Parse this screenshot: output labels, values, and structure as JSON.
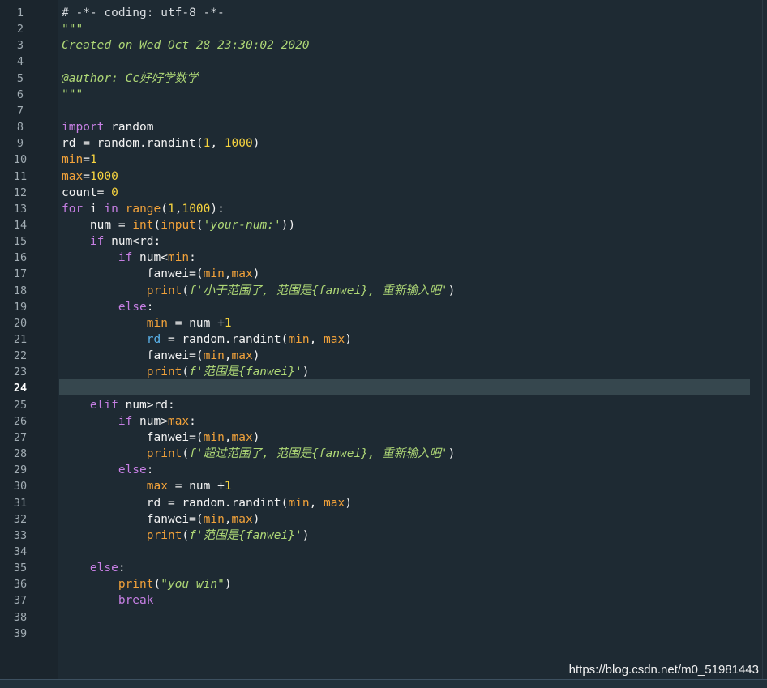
{
  "editor": {
    "current_line": 24,
    "lines": [
      [
        [
          "c",
          "# -*- coding: utf-8 -*-"
        ]
      ],
      [
        [
          "s",
          "\"\"\""
        ]
      ],
      [
        [
          "s",
          "Created on Wed Oct 28 23:30:02 2020"
        ]
      ],
      [],
      [
        [
          "s",
          "@author: Cc好好学数学"
        ]
      ],
      [
        [
          "s",
          "\"\"\""
        ]
      ],
      [],
      [
        [
          "k",
          "import"
        ],
        [
          "p",
          " random"
        ]
      ],
      [
        [
          "p",
          "rd = random.randint("
        ],
        [
          "n",
          "1"
        ],
        [
          "p",
          ", "
        ],
        [
          "n",
          "1000"
        ],
        [
          "p",
          ")"
        ]
      ],
      [
        [
          "v",
          "min"
        ],
        [
          "p",
          "="
        ],
        [
          "n",
          "1"
        ]
      ],
      [
        [
          "v",
          "max"
        ],
        [
          "p",
          "="
        ],
        [
          "n",
          "1000"
        ]
      ],
      [
        [
          "p",
          "count= "
        ],
        [
          "n",
          "0"
        ]
      ],
      [
        [
          "k",
          "for"
        ],
        [
          "p",
          " i "
        ],
        [
          "k",
          "in"
        ],
        [
          "p",
          " "
        ],
        [
          "f",
          "range"
        ],
        [
          "p",
          "("
        ],
        [
          "n",
          "1"
        ],
        [
          "p",
          ","
        ],
        [
          "n",
          "1000"
        ],
        [
          "p",
          "):"
        ]
      ],
      [
        [
          "p",
          "    num = "
        ],
        [
          "f",
          "int"
        ],
        [
          "p",
          "("
        ],
        [
          "f",
          "input"
        ],
        [
          "p",
          "("
        ],
        [
          "s",
          "'your-num:'"
        ],
        [
          "p",
          "))"
        ]
      ],
      [
        [
          "p",
          "    "
        ],
        [
          "k",
          "if"
        ],
        [
          "p",
          " num<rd:"
        ]
      ],
      [
        [
          "p",
          "        "
        ],
        [
          "k",
          "if"
        ],
        [
          "p",
          " num<"
        ],
        [
          "v",
          "min"
        ],
        [
          "p",
          ":"
        ]
      ],
      [
        [
          "p",
          "            fanwei=("
        ],
        [
          "v",
          "min"
        ],
        [
          "p",
          ","
        ],
        [
          "v",
          "max"
        ],
        [
          "p",
          ")"
        ]
      ],
      [
        [
          "p",
          "            "
        ],
        [
          "f",
          "print"
        ],
        [
          "p",
          "("
        ],
        [
          "s",
          "f'小于范围了, 范围是{fanwei}, 重新输入吧'"
        ],
        [
          "p",
          ")"
        ]
      ],
      [
        [
          "p",
          "        "
        ],
        [
          "k",
          "else"
        ],
        [
          "p",
          ":"
        ]
      ],
      [
        [
          "p",
          "            "
        ],
        [
          "v",
          "min"
        ],
        [
          "p",
          " = num +"
        ],
        [
          "n",
          "1"
        ]
      ],
      [
        [
          "p",
          "            "
        ],
        [
          "u",
          "rd"
        ],
        [
          "p",
          " = random.randint("
        ],
        [
          "v",
          "min"
        ],
        [
          "p",
          ", "
        ],
        [
          "v",
          "max"
        ],
        [
          "p",
          ")"
        ]
      ],
      [
        [
          "p",
          "            fanwei=("
        ],
        [
          "v",
          "min"
        ],
        [
          "p",
          ","
        ],
        [
          "v",
          "max"
        ],
        [
          "p",
          ")"
        ]
      ],
      [
        [
          "p",
          "            "
        ],
        [
          "f",
          "print"
        ],
        [
          "p",
          "("
        ],
        [
          "s",
          "f'范围是{fanwei}'"
        ],
        [
          "p",
          ")"
        ]
      ],
      [],
      [
        [
          "p",
          "    "
        ],
        [
          "k",
          "elif"
        ],
        [
          "p",
          " num>rd:"
        ]
      ],
      [
        [
          "p",
          "        "
        ],
        [
          "k",
          "if"
        ],
        [
          "p",
          " num>"
        ],
        [
          "v",
          "max"
        ],
        [
          "p",
          ":"
        ]
      ],
      [
        [
          "p",
          "            fanwei=("
        ],
        [
          "v",
          "min"
        ],
        [
          "p",
          ","
        ],
        [
          "v",
          "max"
        ],
        [
          "p",
          ")"
        ]
      ],
      [
        [
          "p",
          "            "
        ],
        [
          "f",
          "print"
        ],
        [
          "p",
          "("
        ],
        [
          "s",
          "f'超过范围了, 范围是{fanwei}, 重新输入吧'"
        ],
        [
          "p",
          ")"
        ]
      ],
      [
        [
          "p",
          "        "
        ],
        [
          "k",
          "else"
        ],
        [
          "p",
          ":"
        ]
      ],
      [
        [
          "p",
          "            "
        ],
        [
          "v",
          "max"
        ],
        [
          "p",
          " = num +"
        ],
        [
          "n",
          "1"
        ]
      ],
      [
        [
          "p",
          "            rd = random.randint("
        ],
        [
          "v",
          "min"
        ],
        [
          "p",
          ", "
        ],
        [
          "v",
          "max"
        ],
        [
          "p",
          ")"
        ]
      ],
      [
        [
          "p",
          "            fanwei=("
        ],
        [
          "v",
          "min"
        ],
        [
          "p",
          ","
        ],
        [
          "v",
          "max"
        ],
        [
          "p",
          ")"
        ]
      ],
      [
        [
          "p",
          "            "
        ],
        [
          "f",
          "print"
        ],
        [
          "p",
          "("
        ],
        [
          "s",
          "f'范围是{fanwei}'"
        ],
        [
          "p",
          ")"
        ]
      ],
      [],
      [
        [
          "p",
          "    "
        ],
        [
          "k",
          "else"
        ],
        [
          "p",
          ":"
        ]
      ],
      [
        [
          "p",
          "        "
        ],
        [
          "f",
          "print"
        ],
        [
          "p",
          "("
        ],
        [
          "s",
          "\"you win\""
        ],
        [
          "p",
          ")"
        ]
      ],
      [
        [
          "p",
          "        "
        ],
        [
          "k",
          "break"
        ]
      ],
      [],
      []
    ]
  },
  "watermark": "https://blog.csdn.net/m0_51981443",
  "colors": {
    "background": "#1e2a33",
    "gutter": "#1b252d",
    "current_line": "#36474e",
    "keyword": "#c67fe3",
    "string": "#aed776",
    "number": "#f6d33f",
    "variable": "#f2a23a",
    "comment": "#d7dbdf"
  }
}
